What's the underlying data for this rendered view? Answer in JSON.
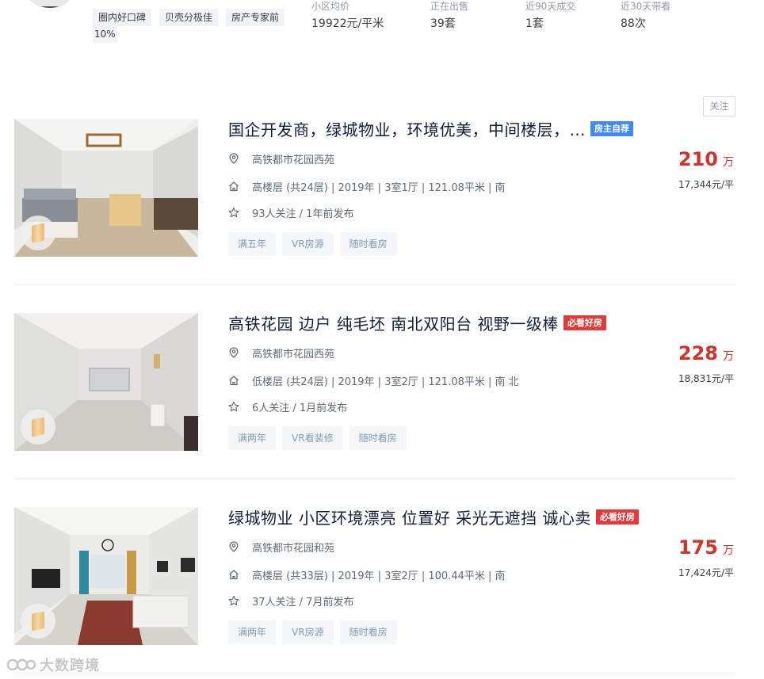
{
  "agent": {
    "tags": [
      "圈内好口碑",
      "贝壳分极佳",
      "房产专家前",
      "10%"
    ],
    "stats": [
      {
        "label": "小区均价",
        "value": "19922元/平米"
      },
      {
        "label": "正在出售",
        "value": "39套"
      },
      {
        "label": "近90天成交",
        "value": "1套"
      },
      {
        "label": "近30天带看",
        "value": "88次"
      }
    ]
  },
  "follow_label": "关注",
  "listings": [
    {
      "title": "国企开发商，绿城物业，环境优美，中间楼层，…",
      "badge": "房主自荐",
      "badge_color": "#3f8af3",
      "community": "高铁都市花园西苑",
      "details": "高楼层 (共24层) | 2019年 | 3室1厅 | 121.08平米 | 南",
      "followers": "93人关注 / 1年前发布",
      "pills": [
        "满五年",
        "VR房源",
        "随时看房"
      ],
      "price": "210",
      "price_unit": "万",
      "unit_price": "17,344元/平"
    },
    {
      "title": "高铁花园 边户 纯毛坯 南北双阳台 视野一级棒",
      "badge": "必看好房",
      "badge_color": "#e03b3b",
      "community": "高铁都市花园西苑",
      "details": "低楼层 (共24层) | 2019年 | 3室2厅 | 121.08平米 | 南 北",
      "followers": "6人关注 / 1月前发布",
      "pills": [
        "满两年",
        "VR看装修",
        "随时看房"
      ],
      "price": "228",
      "price_unit": "万",
      "unit_price": "18,831元/平"
    },
    {
      "title": "绿城物业 小区环境漂亮 位置好 采光无遮挡 诚心卖",
      "badge": "必看好房",
      "badge_color": "#e03b3b",
      "community": "高铁都市花园和苑",
      "details": "高楼层 (共33层) | 2019年 | 3室2厅 | 100.44平米 | 南",
      "followers": "37人关注 / 7月前发布",
      "pills": [
        "满两年",
        "VR房源",
        "随时看房"
      ],
      "price": "175",
      "price_unit": "万",
      "unit_price": "17,424元/平"
    }
  ],
  "watermark": "大数跨境",
  "icons": {
    "community": "location-pin-icon",
    "details": "house-icon",
    "followers": "star-icon"
  }
}
